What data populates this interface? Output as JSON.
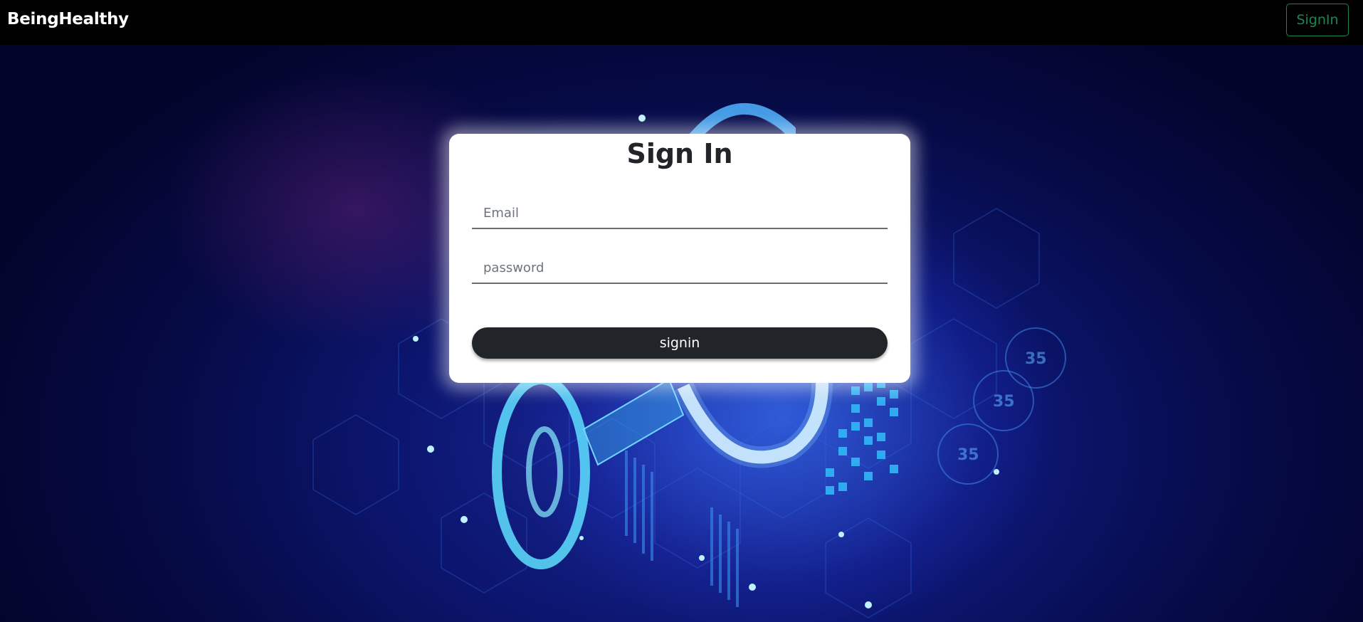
{
  "navbar": {
    "brand": "BeingHealthy",
    "signin_label": "SignIn"
  },
  "form": {
    "title": "Sign In",
    "email_placeholder": "Email",
    "password_placeholder": "password",
    "submit_label": "signin"
  },
  "background": {
    "icon": "security-key-lock-illustration",
    "overlay_text": [
      "35",
      "35",
      "35"
    ]
  },
  "colors": {
    "navbar_bg": "#000000",
    "signin_outline": "#198754",
    "button_dark": "#212529",
    "card_bg": "#ffffff"
  }
}
